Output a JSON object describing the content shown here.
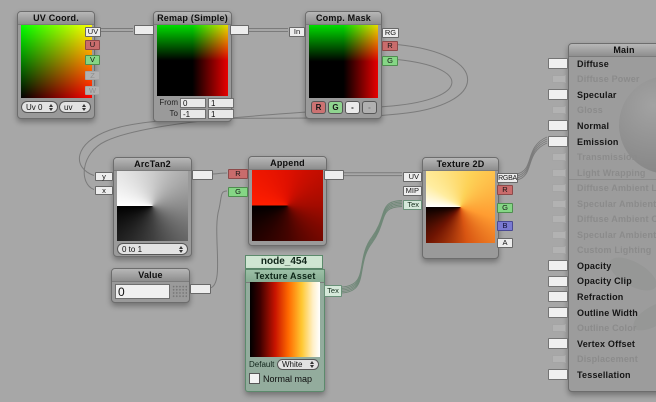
{
  "canvas": {
    "background": "#a7a7a7"
  },
  "colors": {
    "port_red": "#c96c6c",
    "port_green": "#85d685",
    "port_blue": "#7a7ad2",
    "wire_gray": "#7b7b7b",
    "wire_texture": "#708878",
    "node_green": "#8fb69b"
  },
  "nodes": {
    "uv_coord": {
      "title": "UV Coord.",
      "outputs": [
        {
          "label": "UV"
        },
        {
          "label": "U"
        },
        {
          "label": "V"
        },
        {
          "label": "Z"
        },
        {
          "label": "W"
        }
      ],
      "channel_dropdown": "Uv 0",
      "mode_dropdown": "uv"
    },
    "remap": {
      "title": "Remap (Simple)",
      "rows": [
        {
          "label": "From",
          "min": "0",
          "max": "1"
        },
        {
          "label": "To",
          "min": "-1",
          "max": "1"
        }
      ]
    },
    "comp_mask": {
      "title": "Comp. Mask",
      "input": "In",
      "outputs": [
        "RG",
        "R",
        "G"
      ],
      "channel_buttons": [
        "R",
        "G",
        "-",
        "-"
      ]
    },
    "arctan2": {
      "title": "ArcTan2",
      "inputs": [
        "y",
        "x"
      ],
      "range_dropdown": "0 to 1"
    },
    "append": {
      "title": "Append",
      "inputs": [
        "R",
        "G"
      ]
    },
    "value_node": {
      "title": "Value",
      "value": "0"
    },
    "texture_asset": {
      "node_name": "node_454",
      "title": "Texture Asset",
      "output": "Tex",
      "default_label": "Default",
      "default_value": "White",
      "normal_map_label": "Normal map"
    },
    "texture_2d": {
      "title": "Texture 2D",
      "inputs": [
        "UV",
        "MIP",
        "Tex"
      ],
      "outputs": [
        "RGBA",
        "R",
        "G",
        "B",
        "A"
      ]
    },
    "main": {
      "title": "Main",
      "inputs": [
        {
          "label": "Diffuse",
          "active": true
        },
        {
          "label": "Diffuse Power",
          "active": false
        },
        {
          "label": "Specular",
          "active": true
        },
        {
          "label": "Gloss",
          "active": false
        },
        {
          "label": "Normal",
          "active": true
        },
        {
          "label": "Emission",
          "active": true
        },
        {
          "label": "Transmission",
          "active": false
        },
        {
          "label": "Light Wrapping",
          "active": false
        },
        {
          "label": "Diffuse Ambient Light",
          "active": false
        },
        {
          "label": "Specular Ambient Light",
          "active": false
        },
        {
          "label": "Diffuse Ambient Occlusion",
          "active": false
        },
        {
          "label": "Specular Ambient Occlusion",
          "active": false
        },
        {
          "label": "Custom Lighting",
          "active": false
        },
        {
          "label": "Opacity",
          "active": true
        },
        {
          "label": "Opacity Clip",
          "active": true
        },
        {
          "label": "Refraction",
          "active": true
        },
        {
          "label": "Outline Width",
          "active": true
        },
        {
          "label": "Outline Color",
          "active": false
        },
        {
          "label": "Vertex Offset",
          "active": true
        },
        {
          "label": "Displacement",
          "active": false
        },
        {
          "label": "Tessellation",
          "active": true
        }
      ]
    }
  }
}
